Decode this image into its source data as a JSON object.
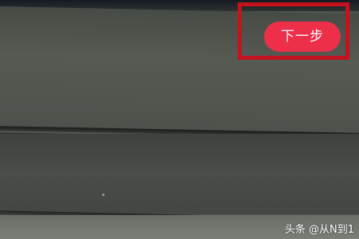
{
  "buttons": {
    "next_label": "下一步"
  },
  "watermark": {
    "text": "头条 @从N到1"
  },
  "colors": {
    "highlight_border": "#c4121e",
    "button_background": "#ee2f4a",
    "button_text": "#ffffff",
    "screen_base": "#4a4e48"
  }
}
